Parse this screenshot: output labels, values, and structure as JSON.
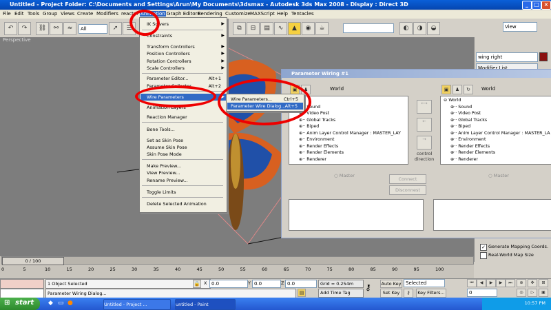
{
  "window": {
    "title": "Untitled   - Project Folder: C:\\Documents and Settings\\Arun\\My Documents\\3dsmax       - Autodesk 3ds Max 2008       - Display : Direct 3D"
  },
  "menubar": [
    "File",
    "Edit",
    "Tools",
    "Group",
    "Views",
    "Create",
    "Modifiers",
    "reactor",
    "Animation",
    "Graph Editors",
    "Rendering",
    "Customize",
    "MAXScript",
    "Help",
    "Tentacles"
  ],
  "toolbar": {
    "selection_filter": "All",
    "view_dropdown": "View"
  },
  "viewport": {
    "label": "Perspective"
  },
  "animation_menu": {
    "items": [
      {
        "label": "IK Solvers",
        "shortcut": "",
        "submenu": true
      },
      {
        "label": "Constraints",
        "shortcut": "",
        "submenu": true
      },
      {
        "label": "Transform Controllers",
        "shortcut": "",
        "submenu": true
      },
      {
        "label": "Position Controllers",
        "shortcut": "",
        "submenu": true
      },
      {
        "label": "Rotation Controllers",
        "shortcut": "",
        "submenu": true
      },
      {
        "label": "Scale Controllers",
        "shortcut": "",
        "submenu": true
      },
      {
        "label": "Parameter Editor...",
        "shortcut": "Alt+1",
        "submenu": false
      },
      {
        "label": "Parameter Collector...",
        "shortcut": "Alt+2",
        "submenu": false
      },
      {
        "label": "Wire Parameters",
        "shortcut": "",
        "submenu": true
      },
      {
        "label": "Animation Layers",
        "shortcut": "",
        "submenu": false
      },
      {
        "label": "Reaction Manager",
        "shortcut": "",
        "submenu": false
      },
      {
        "label": "Bone Tools...",
        "shortcut": "",
        "submenu": false
      },
      {
        "label": "Set as Skin Pose",
        "shortcut": "",
        "submenu": false
      },
      {
        "label": "Assume Skin Pose",
        "shortcut": "",
        "submenu": false
      },
      {
        "label": "Skin Pose Mode",
        "shortcut": "",
        "submenu": false
      },
      {
        "label": "Make Preview...",
        "shortcut": "",
        "submenu": false
      },
      {
        "label": "View Preview...",
        "shortcut": "",
        "submenu": false
      },
      {
        "label": "Rename Preview...",
        "shortcut": "",
        "submenu": false
      },
      {
        "label": "Toggle Limits",
        "shortcut": "",
        "submenu": false
      },
      {
        "label": "Delete Selected Animation",
        "shortcut": "",
        "submenu": false
      }
    ]
  },
  "wire_submenu": {
    "items": [
      {
        "label": "Wire Parameters...",
        "shortcut": "Ctrl+5"
      },
      {
        "label": "Parameter Wire Dialog...",
        "shortcut": "Alt+5"
      }
    ]
  },
  "dialog": {
    "title": "Parameter Wiring #1",
    "left_header": "World",
    "right_header": "World",
    "left_tree": [
      "orld",
      "Sound",
      "Video Post",
      "Global Tracks",
      "Biped",
      "Anim Layer Control Manager : MASTER_LAY",
      "Environment",
      "Render Effects",
      "Render Elements",
      "Renderer"
    ],
    "right_tree": [
      "World",
      "Sound",
      "Video Post",
      "Global Tracks",
      "Biped",
      "Anim Layer Control Manager : MASTER_LA",
      "Environment",
      "Render Effects",
      "Render Elements",
      "Renderer"
    ],
    "control_direction": "control direction",
    "master_left": "Master",
    "master_right": "Master",
    "connect": "Connect",
    "disconnest": "Disconnest"
  },
  "command_panel": {
    "object_name": "wing right",
    "modifier_list": "Modifier List",
    "gen_mapping": "Generate Mapping Coords.",
    "real_world": "Real-World Map Size"
  },
  "timeline": {
    "frame": "0 / 100",
    "ticks": [
      "0",
      "5",
      "10",
      "15",
      "20",
      "25",
      "30",
      "35",
      "40",
      "45",
      "50",
      "55",
      "60",
      "65",
      "70",
      "75",
      "80",
      "85",
      "90",
      "95",
      "100"
    ]
  },
  "status": {
    "selected": "1 Object Selected",
    "prompt": "Parameter Wiring Dialog...",
    "x": "0.0",
    "y": "0.0",
    "z": "0.0",
    "grid": "Grid = 0.254m",
    "add_time_tag": "Add Time Tag",
    "auto_key": "Auto Key",
    "set_key": "Set Key",
    "selected_dd": "Selected",
    "key_filters": "Key Filters...",
    "frame_field": "0"
  },
  "taskbar": {
    "start": "start",
    "tasks": [
      "Untitled    - Project ...",
      "untitled - Paint"
    ],
    "clock": "10:57 PM"
  },
  "colors": {
    "annotation": "#e00000",
    "highlight": "#316ac5"
  }
}
